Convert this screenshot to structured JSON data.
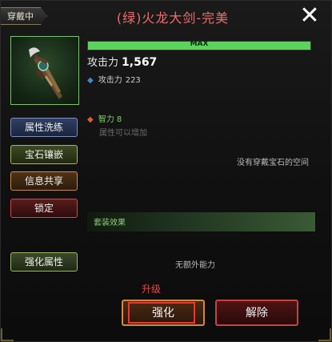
{
  "header": {
    "equip_tag": "穿戴中",
    "title": "(绿)火龙大剑-完美"
  },
  "item": {
    "icon": "sword-icon",
    "level_bar": {
      "label": "MAX",
      "fill": 1.0
    }
  },
  "stats": {
    "main_label": "攻击力",
    "main_value": "1,567",
    "sub_label": "攻击力",
    "sub_value": "223",
    "intel_label": "智力",
    "intel_value": "8",
    "intel_note": "属性可以增加"
  },
  "gems": {
    "empty_text": "没有穿戴宝石的空间"
  },
  "side_buttons": {
    "reforge": "属性洗练",
    "gem_inlay": "宝石镶嵌",
    "info_share": "信息共享",
    "lock": "锁定",
    "enhance_attr": "强化属性"
  },
  "set": {
    "label": "套装效果",
    "no_extra": "无额外能力"
  },
  "actions": {
    "upgrade_hint": "升级",
    "strengthen": "强化",
    "release": "解除"
  },
  "colors": {
    "title": "#ef6c6c",
    "bar": "#5cd45c",
    "accent_red": "#e84a4a"
  }
}
